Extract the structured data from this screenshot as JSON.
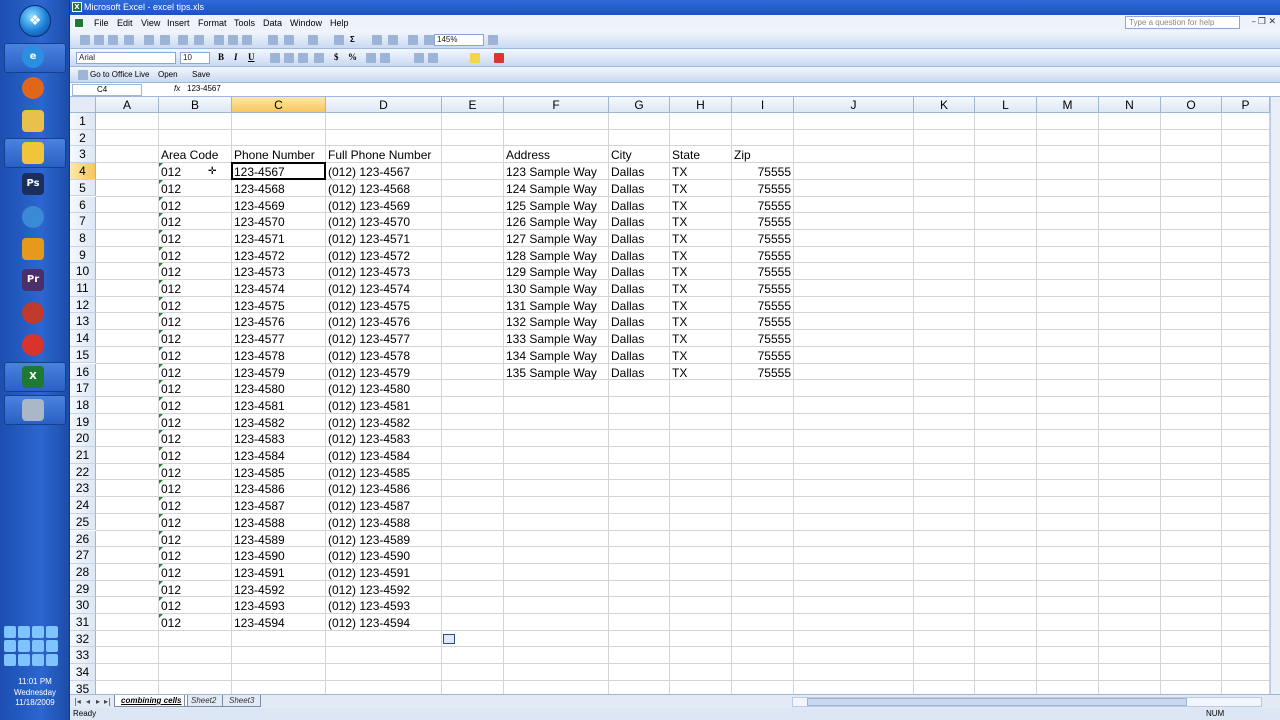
{
  "taskbar": {
    "clock_time": "11:01 PM",
    "clock_day": "Wednesday",
    "clock_date": "11/18/2009",
    "apps": [
      "ie-icon",
      "firefox-icon",
      "folder-icon",
      "notes-icon",
      "photoshop-icon",
      "media-player-icon",
      "powerpoint-icon",
      "premiere-icon",
      "chrome-icon",
      "opera-icon",
      "excel-icon",
      "camera-icon"
    ],
    "app_labels": {
      "photoshop": "Ps",
      "premiere": "Pr"
    }
  },
  "window": {
    "title": "Microsoft Excel - excel tips.xls",
    "help_placeholder": "Type a question for help"
  },
  "menu": [
    "File",
    "Edit",
    "View",
    "Insert",
    "Format",
    "Tools",
    "Data",
    "Window",
    "Help"
  ],
  "toolbar": {
    "zoom": "145%",
    "font_name": "Arial",
    "font_size": "10",
    "bold": "B",
    "italic": "I",
    "underline": "U",
    "currency": "$",
    "percent": "%",
    "sum": "Σ",
    "office_live": "Go to Office Live",
    "open": "Open",
    "save": "Save"
  },
  "formula_bar": {
    "name_box": "C4",
    "fx": "fx",
    "formula": "123-4567"
  },
  "columns": [
    "A",
    "B",
    "C",
    "D",
    "E",
    "F",
    "G",
    "H",
    "I",
    "J",
    "K",
    "L",
    "M",
    "N",
    "O",
    "P"
  ],
  "selected_column": "C",
  "rows": [
    "1",
    "2",
    "3",
    "4",
    "5",
    "6",
    "7",
    "8",
    "9",
    "10",
    "11",
    "12",
    "13",
    "14",
    "15",
    "16",
    "17",
    "18",
    "19",
    "20",
    "21",
    "22",
    "23",
    "24",
    "25",
    "26",
    "27",
    "28",
    "29",
    "30",
    "31",
    "32",
    "33",
    "34",
    "35"
  ],
  "selected_row": "4",
  "headers": {
    "area_code": "Area Code",
    "phone_number": "Phone Number",
    "full_phone": "Full Phone Number",
    "address": "Address",
    "city": "City",
    "state": "State",
    "zip": "Zip"
  },
  "phone_rows": [
    {
      "area": "012",
      "phone": "123-4567",
      "full": "(012) 123-4567"
    },
    {
      "area": "012",
      "phone": "123-4568",
      "full": "(012) 123-4568"
    },
    {
      "area": "012",
      "phone": "123-4569",
      "full": "(012) 123-4569"
    },
    {
      "area": "012",
      "phone": "123-4570",
      "full": "(012) 123-4570"
    },
    {
      "area": "012",
      "phone": "123-4571",
      "full": "(012) 123-4571"
    },
    {
      "area": "012",
      "phone": "123-4572",
      "full": "(012) 123-4572"
    },
    {
      "area": "012",
      "phone": "123-4573",
      "full": "(012) 123-4573"
    },
    {
      "area": "012",
      "phone": "123-4574",
      "full": "(012) 123-4574"
    },
    {
      "area": "012",
      "phone": "123-4575",
      "full": "(012) 123-4575"
    },
    {
      "area": "012",
      "phone": "123-4576",
      "full": "(012) 123-4576"
    },
    {
      "area": "012",
      "phone": "123-4577",
      "full": "(012) 123-4577"
    },
    {
      "area": "012",
      "phone": "123-4578",
      "full": "(012) 123-4578"
    },
    {
      "area": "012",
      "phone": "123-4579",
      "full": "(012) 123-4579"
    },
    {
      "area": "012",
      "phone": "123-4580",
      "full": "(012) 123-4580"
    },
    {
      "area": "012",
      "phone": "123-4581",
      "full": "(012) 123-4581"
    },
    {
      "area": "012",
      "phone": "123-4582",
      "full": "(012) 123-4582"
    },
    {
      "area": "012",
      "phone": "123-4583",
      "full": "(012) 123-4583"
    },
    {
      "area": "012",
      "phone": "123-4584",
      "full": "(012) 123-4584"
    },
    {
      "area": "012",
      "phone": "123-4585",
      "full": "(012) 123-4585"
    },
    {
      "area": "012",
      "phone": "123-4586",
      "full": "(012) 123-4586"
    },
    {
      "area": "012",
      "phone": "123-4587",
      "full": "(012) 123-4587"
    },
    {
      "area": "012",
      "phone": "123-4588",
      "full": "(012) 123-4588"
    },
    {
      "area": "012",
      "phone": "123-4589",
      "full": "(012) 123-4589"
    },
    {
      "area": "012",
      "phone": "123-4590",
      "full": "(012) 123-4590"
    },
    {
      "area": "012",
      "phone": "123-4591",
      "full": "(012) 123-4591"
    },
    {
      "area": "012",
      "phone": "123-4592",
      "full": "(012) 123-4592"
    },
    {
      "area": "012",
      "phone": "123-4593",
      "full": "(012) 123-4593"
    },
    {
      "area": "012",
      "phone": "123-4594",
      "full": "(012) 123-4594"
    }
  ],
  "address_rows": [
    {
      "address": "123 Sample Way",
      "city": "Dallas",
      "state": "TX",
      "zip": "75555"
    },
    {
      "address": "124 Sample Way",
      "city": "Dallas",
      "state": "TX",
      "zip": "75555"
    },
    {
      "address": "125 Sample Way",
      "city": "Dallas",
      "state": "TX",
      "zip": "75555"
    },
    {
      "address": "126 Sample Way",
      "city": "Dallas",
      "state": "TX",
      "zip": "75555"
    },
    {
      "address": "127 Sample Way",
      "city": "Dallas",
      "state": "TX",
      "zip": "75555"
    },
    {
      "address": "128 Sample Way",
      "city": "Dallas",
      "state": "TX",
      "zip": "75555"
    },
    {
      "address": "129 Sample Way",
      "city": "Dallas",
      "state": "TX",
      "zip": "75555"
    },
    {
      "address": "130 Sample Way",
      "city": "Dallas",
      "state": "TX",
      "zip": "75555"
    },
    {
      "address": "131 Sample Way",
      "city": "Dallas",
      "state": "TX",
      "zip": "75555"
    },
    {
      "address": "132 Sample Way",
      "city": "Dallas",
      "state": "TX",
      "zip": "75555"
    },
    {
      "address": "133 Sample Way",
      "city": "Dallas",
      "state": "TX",
      "zip": "75555"
    },
    {
      "address": "134 Sample Way",
      "city": "Dallas",
      "state": "TX",
      "zip": "75555"
    },
    {
      "address": "135 Sample Way",
      "city": "Dallas",
      "state": "TX",
      "zip": "75555"
    }
  ],
  "sheets": [
    "combining cells",
    "Sheet2",
    "Sheet3"
  ],
  "active_sheet": "combining cells",
  "status": {
    "left": "Ready",
    "num": "NUM"
  },
  "colors": {
    "selected_header": "#f8c55e",
    "error_indicator": "#1b8a2c",
    "title_bar": "#1c52c4"
  }
}
